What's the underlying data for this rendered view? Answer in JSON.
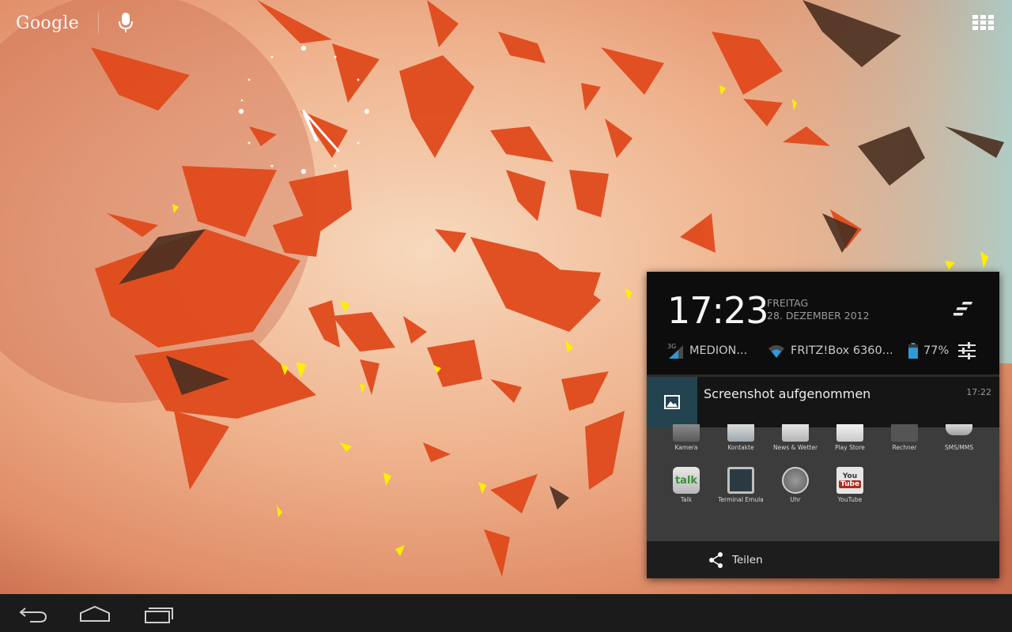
{
  "launcher": {
    "google_logo": "Google",
    "mic_icon": "mic-icon",
    "apps_icon": "all-apps-grid-icon",
    "clock_icon": "analog-clock-widget"
  },
  "navigation": {
    "back_icon": "back-icon",
    "home_icon": "home-icon",
    "recents_icon": "recent-apps-icon"
  },
  "notification_shade": {
    "time": "17:23",
    "day": "FREITAG",
    "date": "28. DEZEMBER 2012",
    "clear_icon": "clear-all-icon",
    "mobile_label": "MEDION...",
    "mobile_type": "3G",
    "wifi_label": "FRITZ!Box 6360...",
    "battery_label": "77%",
    "battery_level": 0.77,
    "settings_icon": "quick-settings-icon"
  },
  "notification": {
    "title": "Screenshot aufgenommen",
    "time": "17:22",
    "icon": "image-icon"
  },
  "preview": {
    "apps": [
      {
        "label": "Kamera"
      },
      {
        "label": "Kontakte"
      },
      {
        "label": "News & Wetter"
      },
      {
        "label": "Play Store"
      },
      {
        "label": "Rechner"
      },
      {
        "label": "SMS/MMS"
      },
      {
        "label": "Talk"
      },
      {
        "label": "Terminal Emula"
      },
      {
        "label": "Uhr"
      },
      {
        "label": "YouTube"
      }
    ],
    "talk_icon_text": "talk",
    "youtube_icon_text_top": "You",
    "youtube_icon_text_bottom": "Tube"
  },
  "share_action": {
    "label": "Teilen",
    "icon": "share-icon"
  },
  "colors": {
    "navbar": "#1b1b1b",
    "shade_header": "#0d0d0d",
    "notification_icon_bg": "#22434f",
    "battery": "#2e9bd6"
  }
}
